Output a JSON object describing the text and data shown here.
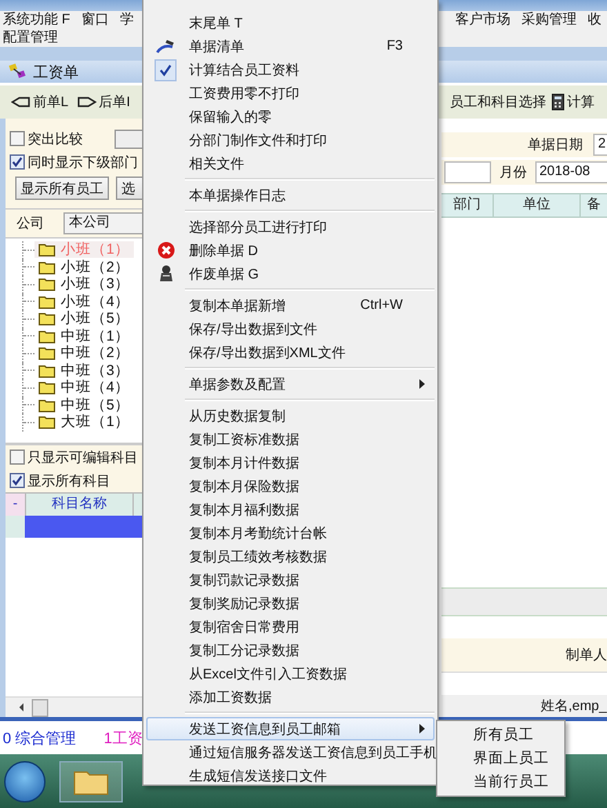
{
  "menu_bar": {
    "left": [
      "系统功能 F",
      "窗口",
      "学"
    ],
    "right": [
      "客户市场",
      "采购管理",
      "收"
    ],
    "second_row": [
      "配置管理"
    ]
  },
  "window": {
    "title": "工资单"
  },
  "toolbar": {
    "left": [
      {
        "label": "前单L",
        "kind": "prev"
      },
      {
        "label": "后单I",
        "kind": "next"
      }
    ],
    "right": [
      {
        "label": "员工和科目选择",
        "kind": "text"
      },
      {
        "label": "计算",
        "kind": "calculator"
      }
    ]
  },
  "filters": {
    "options": [
      {
        "label": "突出比较",
        "checked": false
      },
      {
        "label": "同时显示下级部门",
        "checked": true
      }
    ],
    "buttons": [
      "显示所有员工",
      "选"
    ],
    "company_label": "公司",
    "company_value": "本公司"
  },
  "tree": [
    {
      "label": "小班（1）",
      "selected": true
    },
    {
      "label": "小班（2）",
      "selected": false
    },
    {
      "label": "小班（3）",
      "selected": false
    },
    {
      "label": "小班（4）",
      "selected": false
    },
    {
      "label": "小班（5）",
      "selected": false
    },
    {
      "label": "中班（1）",
      "selected": false
    },
    {
      "label": "中班（2）",
      "selected": false
    },
    {
      "label": "中班（3）",
      "selected": false
    },
    {
      "label": "中班（4）",
      "selected": false
    },
    {
      "label": "中班（5）",
      "selected": false
    },
    {
      "label": "大班（1）",
      "selected": false
    }
  ],
  "subject_options": [
    {
      "label": "只显示可编辑科目",
      "checked": false
    },
    {
      "label": "显示所有科目",
      "checked": true
    }
  ],
  "subject_table": {
    "marker": "-",
    "columns": [
      "科目名称"
    ],
    "rows": [
      {
        "selected": true
      }
    ]
  },
  "form": {
    "date_label": "单据日期",
    "date_value": "2",
    "month_label": "月份",
    "month_value": "2018-08"
  },
  "table": {
    "columns": [
      "部门",
      "单位",
      "备"
    ]
  },
  "footer": {
    "maker_label": "制单人",
    "list_column": "姓名,emp_"
  },
  "status_tabs": [
    {
      "label": "0 综合管理",
      "selected": false
    },
    {
      "label": "1工资",
      "selected": true
    }
  ],
  "context_menu": [
    {
      "kind": "plain",
      "label": "末尾单 T",
      "selected": false
    },
    {
      "kind": "list",
      "label": "单据清单",
      "shortcut": "F3",
      "selected": false
    },
    {
      "kind": "check",
      "label": "计算结合员工资料",
      "checked": true,
      "selected": false
    },
    {
      "kind": "plain",
      "label": "工资费用零不打印",
      "selected": false
    },
    {
      "kind": "plain",
      "label": "保留输入的零",
      "selected": false
    },
    {
      "kind": "plain",
      "label": "分部门制作文件和打印",
      "selected": false
    },
    {
      "kind": "plain",
      "label": "相关文件",
      "selected": false
    },
    {
      "kind": "separator"
    },
    {
      "kind": "plain",
      "label": "本单据操作日志",
      "selected": false
    },
    {
      "kind": "separator"
    },
    {
      "kind": "plain",
      "label": "选择部分员工进行打印",
      "selected": false
    },
    {
      "kind": "delete",
      "label": "删除单据 D",
      "selected": false
    },
    {
      "kind": "void",
      "label": "作废单据 G",
      "selected": false
    },
    {
      "kind": "separator"
    },
    {
      "kind": "plain",
      "label": "复制本单据新增",
      "shortcut": "Ctrl+W",
      "selected": false
    },
    {
      "kind": "plain",
      "label": "保存/导出数据到文件",
      "selected": false
    },
    {
      "kind": "plain",
      "label": "保存/导出数据到XML文件",
      "selected": false
    },
    {
      "kind": "separator"
    },
    {
      "kind": "submenu",
      "label": "单据参数及配置",
      "selected": false
    },
    {
      "kind": "separator"
    },
    {
      "kind": "plain",
      "label": "从历史数据复制",
      "selected": false
    },
    {
      "kind": "plain",
      "label": "复制工资标准数据",
      "selected": false
    },
    {
      "kind": "plain",
      "label": "复制本月计件数据",
      "selected": false
    },
    {
      "kind": "plain",
      "label": "复制本月保险数据",
      "selected": false
    },
    {
      "kind": "plain",
      "label": "复制本月福利数据",
      "selected": false
    },
    {
      "kind": "plain",
      "label": "复制本月考勤统计台帐",
      "selected": false
    },
    {
      "kind": "plain",
      "label": "复制员工绩效考核数据",
      "selected": false
    },
    {
      "kind": "plain",
      "label": "复制罚款记录数据",
      "selected": false
    },
    {
      "kind": "plain",
      "label": "复制奖励记录数据",
      "selected": false
    },
    {
      "kind": "plain",
      "label": "复制宿舍日常费用",
      "selected": false
    },
    {
      "kind": "plain",
      "label": "复制工分记录数据",
      "selected": false
    },
    {
      "kind": "plain",
      "label": "从Excel文件引入工资数据",
      "selected": false
    },
    {
      "kind": "plain",
      "label": "添加工资数据",
      "selected": false
    },
    {
      "kind": "separator"
    },
    {
      "kind": "submenu",
      "label": "发送工资信息到员工邮箱",
      "selected": true
    },
    {
      "kind": "plain",
      "label": "通过短信服务器发送工资信息到员工手机",
      "selected": false
    },
    {
      "kind": "plain",
      "label": "生成短信发送接口文件",
      "selected": false
    }
  ],
  "submenu": [
    "所有员工",
    "界面上员工",
    "当前行员工"
  ]
}
